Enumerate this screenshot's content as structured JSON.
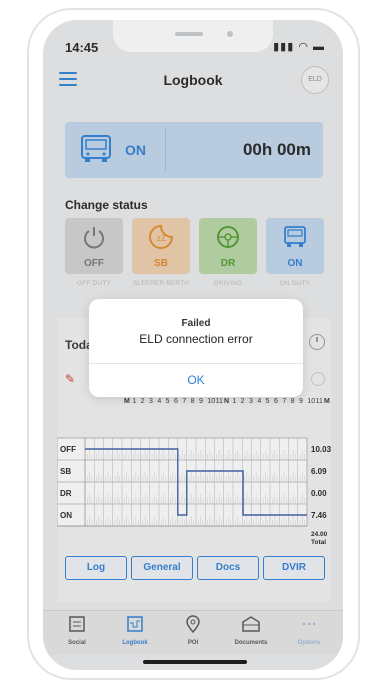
{
  "status_bar": {
    "time": "14:45"
  },
  "header": {
    "title": "Logbook",
    "eld_badge": "ELD"
  },
  "current_status": {
    "status": "ON",
    "timer": "00h 00m"
  },
  "change_status": {
    "label": "Change status",
    "options": [
      {
        "code": "OFF",
        "caption": "OFF DUTY",
        "bg": "#d2d2d2",
        "color": "#777777"
      },
      {
        "code": "SB",
        "caption": "SLEEPER BERTH",
        "bg": "#efcfab",
        "color": "#e28a2b"
      },
      {
        "code": "DR",
        "caption": "DRIVING",
        "bg": "#b9d7a6",
        "color": "#4f9a2b"
      },
      {
        "code": "ON",
        "caption": "ON DUTY",
        "bg": "#c2d7ec",
        "color": "#2c7fd6"
      }
    ]
  },
  "log": {
    "today_label": "Toda",
    "hour_labels": [
      "M",
      "1",
      "2",
      "3",
      "4",
      "5",
      "6",
      "7",
      "8",
      "9",
      "10",
      "11",
      "N",
      "1",
      "2",
      "3",
      "4",
      "5",
      "6",
      "7",
      "8",
      "9",
      "10",
      "11",
      "M"
    ],
    "rows": [
      {
        "label": "OFF",
        "total": "10.03"
      },
      {
        "label": "SB",
        "total": "6.09"
      },
      {
        "label": "DR",
        "total": "0.00"
      },
      {
        "label": "ON",
        "total": "7.46"
      }
    ],
    "grand_total": "24.00",
    "total_label": "Total"
  },
  "tabs": [
    "Log",
    "General",
    "Docs",
    "DVIR"
  ],
  "bottom_nav": [
    "Social",
    "Logbook",
    "POI",
    "Documents",
    "Options"
  ],
  "dialog": {
    "title": "Failed",
    "message": "ELD connection error",
    "ok": "OK"
  },
  "colors": {
    "accent": "#2c7fd6"
  }
}
